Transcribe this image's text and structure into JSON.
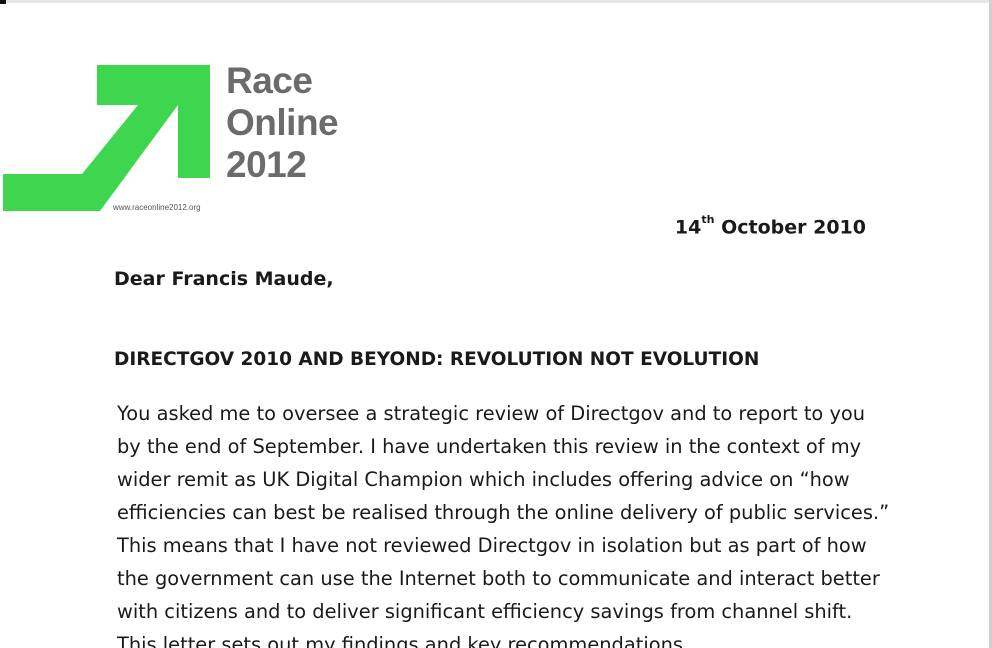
{
  "logo": {
    "lines": [
      "Race",
      "Online",
      "2012"
    ],
    "url": "www.raceonline2012.org",
    "arrow_color": "#3fd64f",
    "text_color": "#6b6b6b"
  },
  "letter": {
    "date_day": "14",
    "date_suffix": "th",
    "date_rest": " October 2010",
    "salutation": "Dear Francis Maude,",
    "heading": "DIRECTGOV 2010 AND BEYOND: REVOLUTION NOT EVOLUTION",
    "body_lines": [
      "You asked me to oversee a strategic review of Directgov and to report to you",
      "by the end of September.  I have undertaken this review in the context of my",
      "wider remit as UK Digital Champion which includes offering advice on “how",
      "efficiencies can best be realised through the online delivery of public services.”",
      "This means that I have not reviewed Directgov in isolation but as part of how",
      "the government can use the Internet both to communicate and interact better",
      "with citizens and to deliver significant efficiency savings from channel shift.",
      "This letter sets out my findings and key recommendations."
    ]
  }
}
